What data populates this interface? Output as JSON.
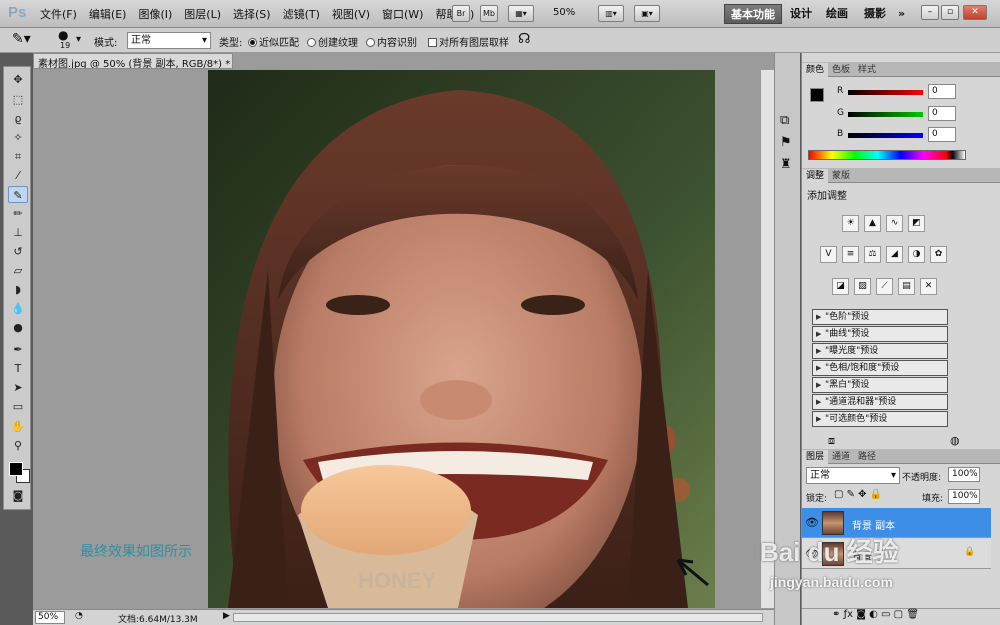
{
  "app": {
    "logo": "Ps"
  },
  "menu": [
    "文件(F)",
    "编辑(E)",
    "图像(I)",
    "图层(L)",
    "选择(S)",
    "滤镜(T)",
    "视图(V)",
    "窗口(W)",
    "帮助(H)"
  ],
  "menubar_buttons": {
    "br": "Br",
    "mb": "Mb",
    "zoom": "50%"
  },
  "workspaces": {
    "active": "基本功能",
    "items": [
      "设计",
      "绘画",
      "摄影"
    ],
    "more": "»"
  },
  "options_bar": {
    "brush_size": "19",
    "mode_label": "模式:",
    "mode_value": "正常",
    "type_label": "类型:",
    "type_options": [
      "近似匹配",
      "创建纹理",
      "内容识别"
    ],
    "sample_all": "对所有图层取样"
  },
  "document": {
    "tab_title": "素材图.jpg @ 50% (背景 副本, RGB/8*) *",
    "status_zoom": "50%",
    "status_doc": "文档:6.64M/13.3M"
  },
  "caption": "最终效果如图所示",
  "color_panel": {
    "tabs": [
      "颜色",
      "色板",
      "样式"
    ],
    "channels": [
      {
        "name": "R",
        "value": "0"
      },
      {
        "name": "G",
        "value": "0"
      },
      {
        "name": "B",
        "value": "0"
      }
    ]
  },
  "adjust_panel": {
    "tabs": [
      "调整",
      "蒙版"
    ],
    "title": "添加调整",
    "presets": [
      "\"色阶\"预设",
      "\"曲线\"预设",
      "\"曝光度\"预设",
      "\"色相/饱和度\"预设",
      "\"黑白\"预设",
      "\"通道混和器\"预设",
      "\"可选颜色\"预设"
    ]
  },
  "layers_panel": {
    "tabs": [
      "图层",
      "通道",
      "路径"
    ],
    "blend_mode": "正常",
    "opacity_label": "不透明度:",
    "opacity": "100%",
    "lock_label": "锁定:",
    "fill_label": "填充:",
    "fill": "100%",
    "layers": [
      {
        "name": "背景 副本",
        "selected": true
      },
      {
        "name": "背景",
        "selected": false
      }
    ]
  },
  "watermark": {
    "brand": "Bai du 经验",
    "url": "jingyan.baidu.com"
  }
}
